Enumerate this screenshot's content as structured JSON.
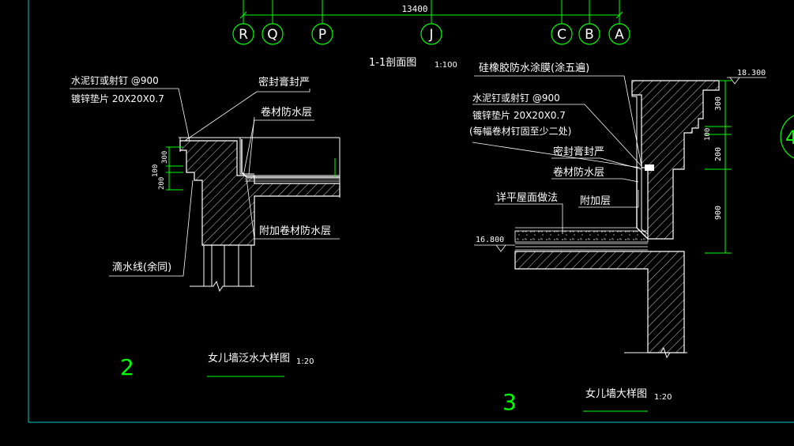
{
  "colors": {
    "background": "#000000",
    "linework": "#ffffff",
    "dimension": "#00ff00",
    "axis_circle": "#00ff00",
    "border": "#00c8c8",
    "number_green": "#00ff00",
    "hatch": "#ffffff"
  },
  "top_axes": {
    "total_dimension": "13400",
    "labels": [
      "R",
      "Q",
      "P",
      "J",
      "C",
      "B",
      "A"
    ]
  },
  "section_title": {
    "name": "1-1剖面图",
    "scale": "1:100"
  },
  "detail_2": {
    "number": "2",
    "title": "女儿墙泛水大样图",
    "scale": "1:20",
    "notes": {
      "nail_line1": "水泥钉或射钉 @900",
      "nail_line2": "镀锌垫片 20X20X0.7",
      "sealant": "密封膏封严",
      "membrane": "卷材防水层",
      "extra_membrane": "附加卷材防水层",
      "drip": "滴水线(余同)"
    },
    "dims": [
      "300",
      "100",
      "200"
    ]
  },
  "detail_3": {
    "number": "3",
    "title": "女儿墙大样图",
    "scale": "1:20",
    "notes": {
      "coating": "硅橡胶防水涂膜(涂五遍)",
      "nail_line1": "水泥钉或射钉 @900",
      "nail_line2": "镀锌垫片 20X20X0.7",
      "nail_line3": "(每幅卷材钉固至少二处)",
      "sealant": "密封膏封严",
      "membrane": "卷材防水层",
      "roof": "详平屋面做法",
      "extra": "附加层"
    },
    "elevations": {
      "top": "18.300",
      "roof": "16.800"
    },
    "dims": [
      "300",
      "100",
      "200",
      "900"
    ],
    "side_marker": "4"
  }
}
